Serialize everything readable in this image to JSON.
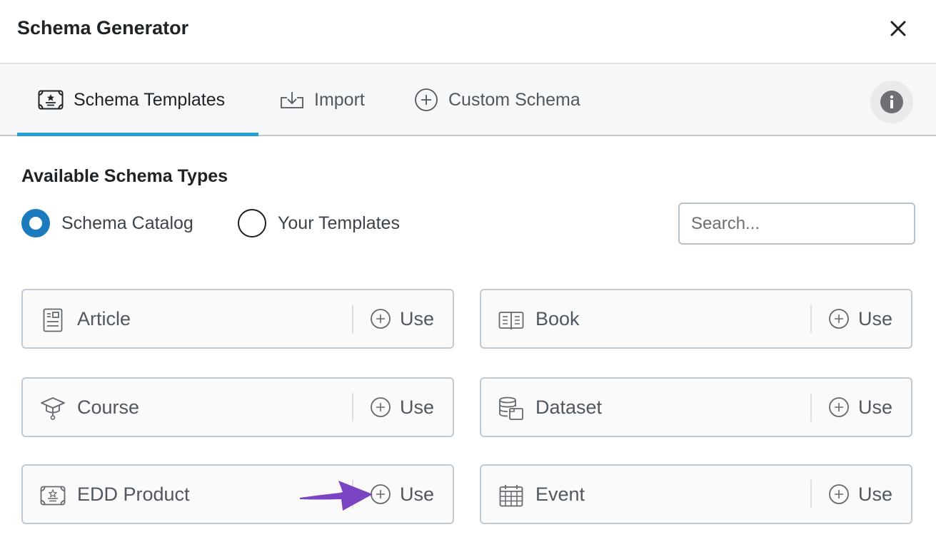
{
  "dialog": {
    "title": "Schema Generator",
    "close_icon": "close-icon"
  },
  "tabs": [
    {
      "label": "Schema Templates",
      "icon": "certificate-icon",
      "active": true
    },
    {
      "label": "Import",
      "icon": "import-icon",
      "active": false
    },
    {
      "label": "Custom Schema",
      "icon": "plus-circle-icon",
      "active": false
    }
  ],
  "info_button": {
    "icon": "info-icon"
  },
  "section": {
    "title": "Available Schema Types"
  },
  "source_options": [
    {
      "label": "Schema Catalog",
      "checked": true
    },
    {
      "label": "Your Templates",
      "checked": false
    }
  ],
  "search": {
    "placeholder": "Search...",
    "value": ""
  },
  "schema_types": [
    {
      "name": "Article",
      "icon": "article-icon",
      "action": "Use"
    },
    {
      "name": "Book",
      "icon": "book-icon",
      "action": "Use"
    },
    {
      "name": "Course",
      "icon": "graduation-cap-icon",
      "action": "Use"
    },
    {
      "name": "Dataset",
      "icon": "database-icon",
      "action": "Use"
    },
    {
      "name": "EDD Product",
      "icon": "certificate-icon",
      "action": "Use"
    },
    {
      "name": "Event",
      "icon": "calendar-icon",
      "action": "Use"
    }
  ],
  "annotation": {
    "type": "arrow",
    "target": "EDD Product use button",
    "color": "#7a44c2"
  },
  "colors": {
    "accent": "#24a0d2",
    "radio_checked": "#1b7bbd",
    "text_muted": "#50575e"
  }
}
